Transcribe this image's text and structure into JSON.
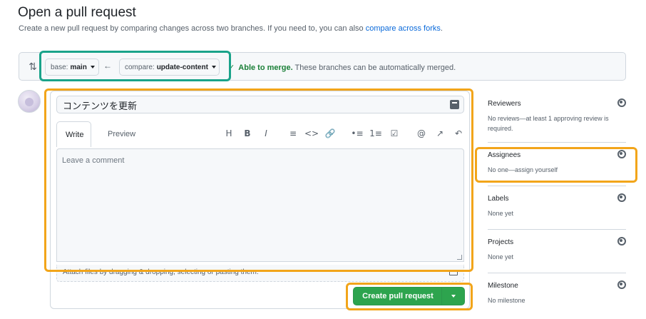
{
  "page": {
    "title": "Open a pull request",
    "subtitle_text": "Create a new pull request by comparing changes across two branches. If you need to, you can also",
    "subtitle_link": "compare across forks",
    "subtitle_end": "."
  },
  "range": {
    "base_prefix": "base:",
    "base_branch": "main",
    "compare_prefix": "compare:",
    "compare_branch": "update-content",
    "merge_ok": "Able to merge.",
    "merge_text": "These branches can be automatically merged."
  },
  "editor": {
    "title_value": "コンテンツを更新",
    "tab_write": "Write",
    "tab_preview": "Preview",
    "toolbar": [
      "H",
      "B",
      "I",
      "≡",
      "<>",
      "🔗",
      "•≡",
      "1≡",
      "☑",
      "@",
      "↗",
      "↶"
    ],
    "comment_placeholder": "Leave a comment",
    "attach_text": "Attach files by dragging & dropping, selecting or pasting them.",
    "create_button": "Create pull request"
  },
  "sidebar": {
    "reviewers_label": "Reviewers",
    "reviewers_value": "No reviews—at least 1 approving review is required.",
    "assignees_label": "Assignees",
    "assignees_value": "No one—assign yourself",
    "labels_label": "Labels",
    "labels_value": "None yet",
    "projects_label": "Projects",
    "projects_value": "None yet",
    "milestone_label": "Milestone",
    "milestone_value": "No milestone"
  },
  "colors": {
    "accent_green": "#2da44e",
    "link_blue": "#0969da",
    "highlight_teal": "#1aa38a",
    "highlight_orange": "#f2a51a"
  }
}
